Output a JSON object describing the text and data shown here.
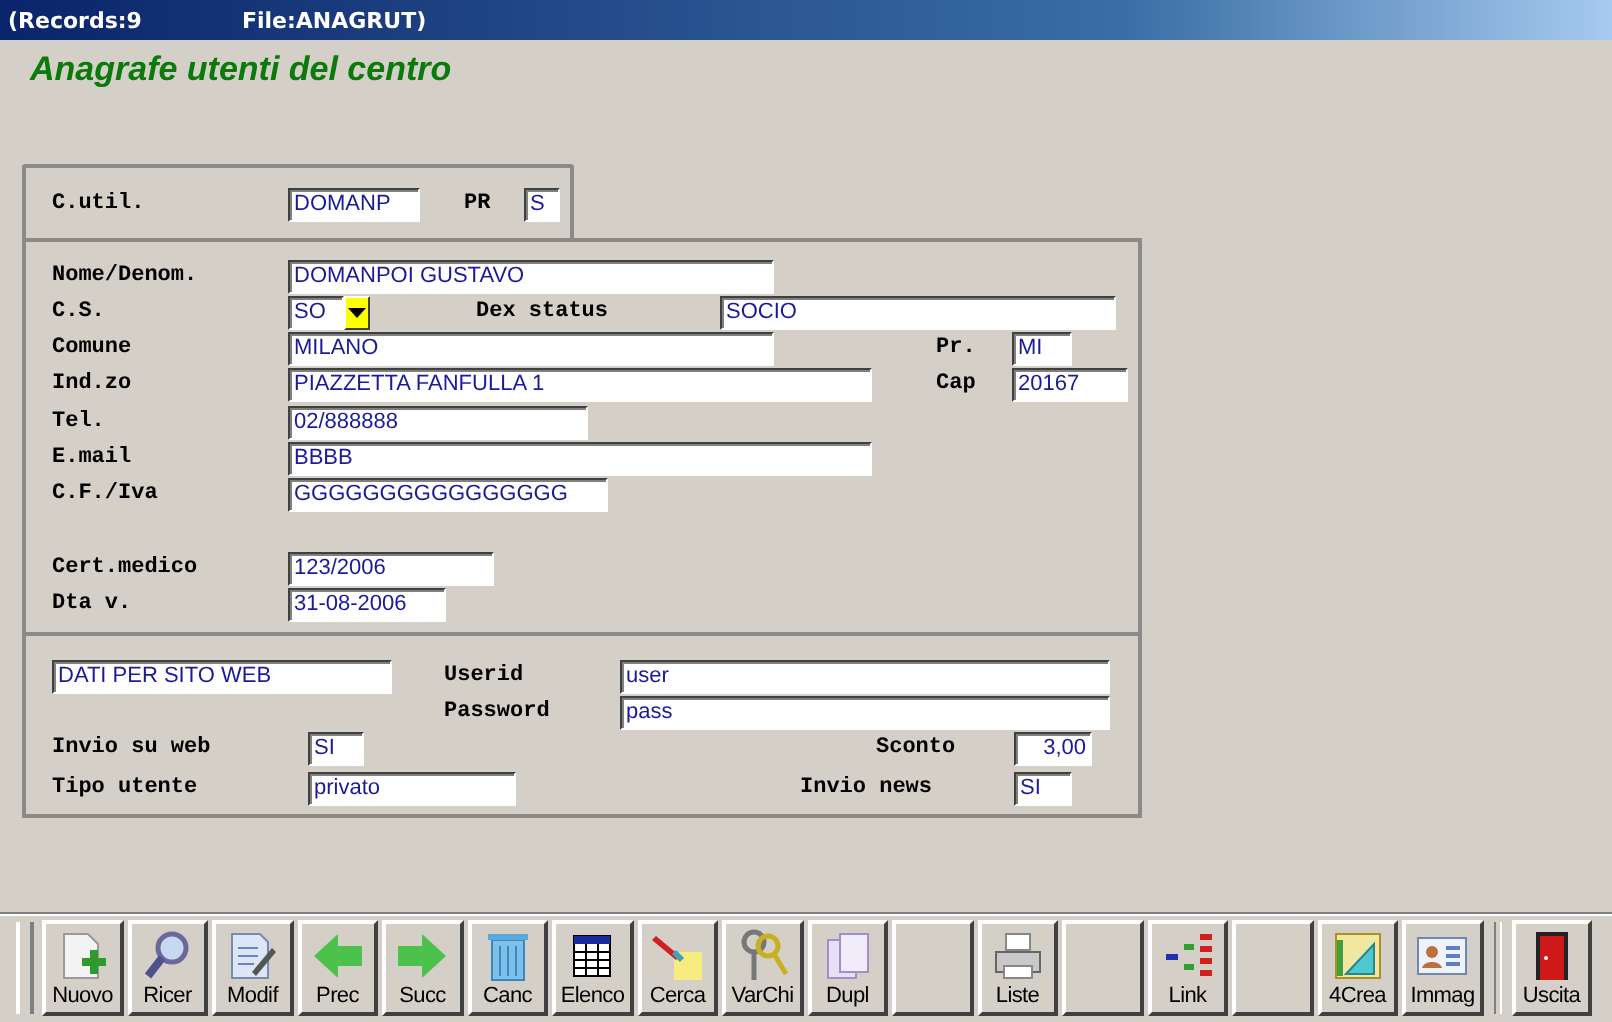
{
  "title_bar": {
    "records": "(Records:9",
    "file": "File:ANAGRUT)"
  },
  "heading": "Anagrafe utenti del centro",
  "sections": [
    {
      "rows": [
        [
          {
            "kind": "label",
            "text": "C.util."
          },
          {
            "kind": "field",
            "value": "DOMANP"
          },
          {
            "kind": "label",
            "text": "PR"
          },
          {
            "kind": "field",
            "value": "S"
          }
        ]
      ]
    },
    {
      "rows": [
        [
          {
            "kind": "label",
            "text": "Nome/Denom."
          },
          {
            "kind": "field",
            "value": "DOMANPOI GUSTAVO"
          }
        ],
        [
          {
            "kind": "label",
            "text": "C.S."
          },
          {
            "kind": "combo",
            "value": "SO"
          },
          {
            "kind": "label",
            "text": "Dex status"
          },
          {
            "kind": "field",
            "value": "SOCIO"
          }
        ],
        [
          {
            "kind": "label",
            "text": "Comune"
          },
          {
            "kind": "field",
            "value": "MILANO"
          },
          {
            "kind": "label",
            "text": "Pr."
          },
          {
            "kind": "field",
            "value": "MI"
          }
        ],
        [
          {
            "kind": "label",
            "text": "Ind.zo"
          },
          {
            "kind": "field",
            "value": "PIAZZETTA FANFULLA 1"
          },
          {
            "kind": "label",
            "text": "Cap"
          },
          {
            "kind": "field",
            "value": "20167"
          }
        ],
        [
          {
            "kind": "label",
            "text": "Tel."
          },
          {
            "kind": "field",
            "value": "02/888888"
          }
        ],
        [
          {
            "kind": "label",
            "text": "E.mail"
          },
          {
            "kind": "field",
            "value": "BBBB"
          }
        ],
        [
          {
            "kind": "label",
            "text": "C.F./Iva"
          },
          {
            "kind": "field",
            "value": "GGGGGGGGGGGGGGGG"
          }
        ],
        [
          {
            "kind": "label",
            "text": "Cert.medico"
          },
          {
            "kind": "field",
            "value": "123/2006"
          }
        ],
        [
          {
            "kind": "label",
            "text": "Dta v."
          },
          {
            "kind": "field",
            "value": "31-08-2006"
          }
        ]
      ]
    },
    {
      "rows": [
        [
          {
            "kind": "field",
            "value": "DATI PER SITO WEB"
          },
          {
            "kind": "label",
            "text": "Userid"
          },
          {
            "kind": "field",
            "value": "user"
          }
        ],
        [
          {
            "kind": "label",
            "text": "Password"
          },
          {
            "kind": "field",
            "value": "pass"
          }
        ],
        [
          {
            "kind": "label",
            "text": "Invio su web"
          },
          {
            "kind": "field",
            "value": "SI"
          },
          {
            "kind": "label",
            "text": "Sconto"
          },
          {
            "kind": "number",
            "value": "3,00"
          }
        ],
        [
          {
            "kind": "label",
            "text": "Tipo utente"
          },
          {
            "kind": "field",
            "value": "privato"
          },
          {
            "kind": "label",
            "text": "Invio news"
          },
          {
            "kind": "field",
            "value": "SI"
          }
        ]
      ]
    }
  ],
  "toolbar": [
    {
      "kind": "new",
      "label": "Nuovo"
    },
    {
      "kind": "search",
      "label": "Ricer"
    },
    {
      "kind": "edit",
      "label": "Modif"
    },
    {
      "kind": "prev",
      "label": "Prec"
    },
    {
      "kind": "next",
      "label": "Succ"
    },
    {
      "kind": "delete",
      "label": "Canc"
    },
    {
      "kind": "list",
      "label": "Elenco"
    },
    {
      "kind": "find",
      "label": "Cerca"
    },
    {
      "kind": "keys",
      "label": "VarChi"
    },
    {
      "kind": "copy",
      "label": "Dupl"
    },
    {
      "kind": "blank"
    },
    {
      "kind": "print",
      "label": "Liste"
    },
    {
      "kind": "blank"
    },
    {
      "kind": "link",
      "label": "Link"
    },
    {
      "kind": "blank"
    },
    {
      "kind": "design",
      "label": "4Crea"
    },
    {
      "kind": "card",
      "label": "Immag"
    },
    {
      "kind": "exit",
      "label": "Uscita"
    }
  ]
}
